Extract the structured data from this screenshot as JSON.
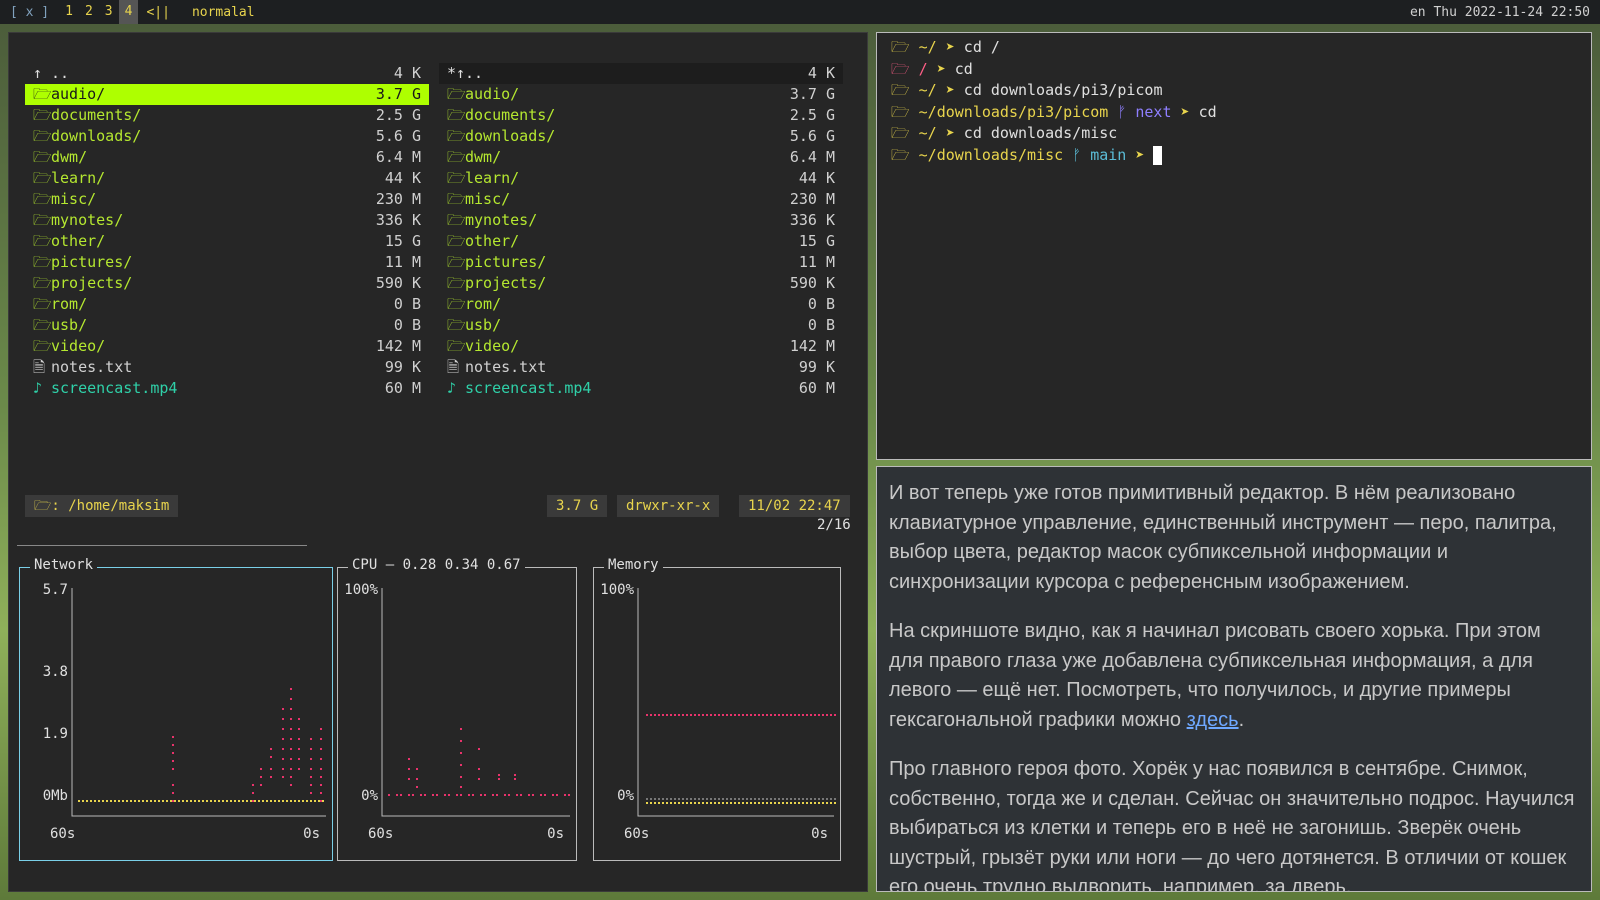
{
  "topbar": {
    "close": "[ x ]",
    "workspaces": [
      "1",
      "2",
      "3",
      "4"
    ],
    "active_workspace": "4",
    "layout": "<||",
    "title": "normalal",
    "status": "en Thu 2022-11-24 22:50"
  },
  "filemanager": {
    "left_rows": [
      {
        "icon": "↑",
        "name": "..",
        "size": "4 K",
        "type": "up"
      },
      {
        "icon": "🗁",
        "name": "audio/",
        "size": "3.7 G",
        "type": "dir",
        "selected": true
      },
      {
        "icon": "🗁",
        "name": "documents/",
        "size": "2.5 G",
        "type": "dir"
      },
      {
        "icon": "🗁",
        "name": "downloads/",
        "size": "5.6 G",
        "type": "dir"
      },
      {
        "icon": "🗁",
        "name": "dwm/",
        "size": "6.4 M",
        "type": "dir"
      },
      {
        "icon": "🗁",
        "name": "learn/",
        "size": "44 K",
        "type": "dir"
      },
      {
        "icon": "🗁",
        "name": "misc/",
        "size": "230 M",
        "type": "dir"
      },
      {
        "icon": "🗁",
        "name": "mynotes/",
        "size": "336 K",
        "type": "dir"
      },
      {
        "icon": "🗁",
        "name": "other/",
        "size": "15 G",
        "type": "dir"
      },
      {
        "icon": "🗁",
        "name": "pictures/",
        "size": "11 M",
        "type": "dir"
      },
      {
        "icon": "🗁",
        "name": "projects/",
        "size": "590 K",
        "type": "dir"
      },
      {
        "icon": "🗁",
        "name": "rom/",
        "size": "0 B",
        "type": "dir"
      },
      {
        "icon": "🗁",
        "name": "usb/",
        "size": "0 B",
        "type": "dir"
      },
      {
        "icon": "🗁",
        "name": "video/",
        "size": "142 M",
        "type": "dir"
      },
      {
        "icon": "🗎",
        "name": "notes.txt",
        "size": "99 K",
        "type": "file"
      },
      {
        "icon": "♪",
        "name": "screencast.mp4",
        "size": "60 M",
        "type": "media"
      }
    ],
    "right_rows": [
      {
        "icon": "*↑",
        "name": "..",
        "size": "4 K",
        "type": "up",
        "current": true
      },
      {
        "icon": "🗁",
        "name": "audio/",
        "size": "3.7 G",
        "type": "dir"
      },
      {
        "icon": "🗁",
        "name": "documents/",
        "size": "2.5 G",
        "type": "dir"
      },
      {
        "icon": "🗁",
        "name": "downloads/",
        "size": "5.6 G",
        "type": "dir"
      },
      {
        "icon": "🗁",
        "name": "dwm/",
        "size": "6.4 M",
        "type": "dir"
      },
      {
        "icon": "🗁",
        "name": "learn/",
        "size": "44 K",
        "type": "dir"
      },
      {
        "icon": "🗁",
        "name": "misc/",
        "size": "230 M",
        "type": "dir"
      },
      {
        "icon": "🗁",
        "name": "mynotes/",
        "size": "336 K",
        "type": "dir"
      },
      {
        "icon": "🗁",
        "name": "other/",
        "size": "15 G",
        "type": "dir"
      },
      {
        "icon": "🗁",
        "name": "pictures/",
        "size": "11 M",
        "type": "dir"
      },
      {
        "icon": "🗁",
        "name": "projects/",
        "size": "590 K",
        "type": "dir"
      },
      {
        "icon": "🗁",
        "name": "rom/",
        "size": "0 B",
        "type": "dir"
      },
      {
        "icon": "🗁",
        "name": "usb/",
        "size": "0 B",
        "type": "dir"
      },
      {
        "icon": "🗁",
        "name": "video/",
        "size": "142 M",
        "type": "dir"
      },
      {
        "icon": "🗎",
        "name": "notes.txt",
        "size": "99 K",
        "type": "file"
      },
      {
        "icon": "♪",
        "name": "screencast.mp4",
        "size": "60 M",
        "type": "media"
      }
    ],
    "path": "🗁: /home/maksim",
    "size": "3.7 G",
    "perms": "drwxr-xr-x",
    "date": "11/02 22:47",
    "position": "2/16"
  },
  "graphs": {
    "network": {
      "title": "Network",
      "ticks": [
        "5.7",
        "3.8",
        "1.9",
        "0Mb"
      ],
      "x_start": "60s",
      "x_end": "0s"
    },
    "cpu": {
      "title": "CPU — 0.28 0.34 0.67",
      "ticks": [
        "100%",
        "0%"
      ],
      "x_start": "60s",
      "x_end": "0s"
    },
    "memory": {
      "title": "Memory",
      "ticks": [
        "100%",
        "0%"
      ],
      "x_start": "60s",
      "x_end": "0s"
    },
    "colors": {
      "primary": "#e8336b",
      "secondary": "#e8d44d"
    }
  },
  "terminal": {
    "lines": [
      {
        "path": "~/",
        "branch": "",
        "cmd": "cd /",
        "pathcolor": "#e8d44d"
      },
      {
        "path": "/",
        "branch": "",
        "cmd": "cd",
        "pathcolor": "#ff5f87"
      },
      {
        "path": "~/",
        "branch": "",
        "cmd": "cd downloads/pi3/picom",
        "pathcolor": "#e8d44d"
      },
      {
        "path": "~/downloads/pi3/picom",
        "branch": "next",
        "cmd": "cd",
        "pathcolor": "#e8d44d"
      },
      {
        "path": "~/",
        "branch": "",
        "cmd": "cd downloads/misc",
        "pathcolor": "#e8d44d"
      },
      {
        "path": "~/downloads/misc",
        "branch": "main",
        "cmd": "",
        "pathcolor": "#e8d44d",
        "cursor": true
      }
    ]
  },
  "doc": {
    "p1": "И вот теперь уже готов примитивный редактор. В нём реализовано клавиатурное управление, единственный инструмент — перо, палитра, выбор цвета, редактор масок субпиксельной информации и синхронизации курсора с референсным изображением.",
    "p2a": "На скриншоте видно, как я начинал рисовать своего хорька. При этом для правого глаза уже добавлена субпиксельная информация, а для левого — ещё нет. Посмотреть, что получилось, и другие примеры гексагональной графики можно ",
    "p2link": "здесь",
    "p2b": ".",
    "p3": "Про главного героя фото. Хорёк у нас появился в сентябре. Снимок, собственно, тогда же и сделан. Сейчас он значительно подрос. Научился выбираться из клетки и теперь его в неё не загонишь. Зверёк очень шустрый, грызёт руки или ноги — до чего дотянется. В отличии от кошек его очень трудно выдворить, например, за дверь."
  }
}
